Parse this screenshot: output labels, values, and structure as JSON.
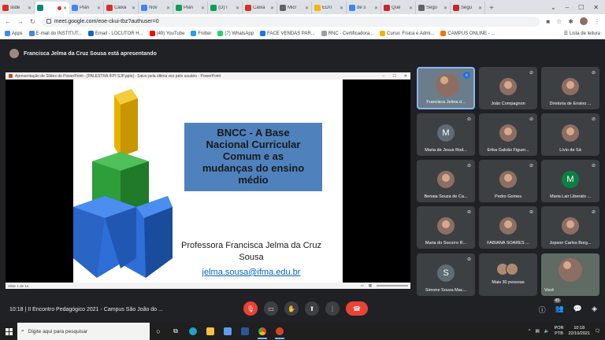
{
  "browser": {
    "tabs": [
      {
        "label": "slide",
        "favicon": "gmail-icon",
        "color": "#d93025"
      },
      {
        "label": "",
        "favicon": "meet-icon",
        "color": "#00897b",
        "active": true,
        "recording": true
      },
      {
        "label": "Plan",
        "favicon": "docs-icon",
        "color": "#4285f4"
      },
      {
        "label": "Caixa",
        "favicon": "gmail-icon",
        "color": "#d93025"
      },
      {
        "label": "Nov",
        "favicon": "docs-icon",
        "color": "#4285f4"
      },
      {
        "label": "Plan",
        "favicon": "sheets-icon",
        "color": "#0f9d58"
      },
      {
        "label": "(D) I",
        "favicon": "sheets-icon",
        "color": "#0f9d58"
      },
      {
        "label": "Caixa",
        "favicon": "gmail-icon",
        "color": "#d93025"
      },
      {
        "label": "Micr",
        "favicon": "globe-icon",
        "color": "#5f6368"
      },
      {
        "label": "EDIT",
        "favicon": "edit-icon",
        "color": "#f4b400"
      },
      {
        "label": "de s",
        "favicon": "google-icon",
        "color": "#4285f4"
      },
      {
        "label": "Que",
        "favicon": "m-icon",
        "color": "#c62828"
      },
      {
        "label": "Segu",
        "favicon": "globe-icon",
        "color": "#5f6368"
      },
      {
        "label": "Segu",
        "favicon": "m-icon",
        "color": "#c62828"
      }
    ],
    "url": "meet.google.com/eoe-ckui-tbz?authuser=0",
    "bookmarks": [
      {
        "label": "Apps",
        "color": "#4285f4"
      },
      {
        "label": "E-mail do INSTITUT...",
        "color": "#4285f4"
      },
      {
        "label": "Email - LOCUTOR H...",
        "color": "#1565c0"
      },
      {
        "label": "(49) YouTube",
        "color": "#ff0000"
      },
      {
        "label": "Fnitter",
        "color": "#1da1f2"
      },
      {
        "label": "(7) WhatsApp",
        "color": "#25d366"
      },
      {
        "label": "FACE VENDAS PAR...",
        "color": "#1877f2"
      },
      {
        "label": "RNC - Certificadora...",
        "color": "#9e9e9e"
      },
      {
        "label": "Curso: Física e Admi...",
        "color": "#f4b400"
      },
      {
        "label": "CAMPUS ONLINE - ...",
        "color": "#ff6f00"
      }
    ],
    "reading_list": "Lista de leitura"
  },
  "meet": {
    "presenting": "Francisca Jelma da Cruz Sousa está apresentando",
    "ppt_window_title": "Apresentação de Slides do PowerPoint - [PALESTRA IFPI SJP.pptx] - Salvo pela última vez pelo usuário - PowerPoint",
    "ppt_status": "Slide 1 de 14",
    "slide": {
      "title": "BNCC - A Base\nNacional Curricular\nComum e as\nmudanças do ensino\nmédio",
      "author": "Professora Francisca Jelma da Cruz Sousa",
      "email": "jelma.sousa@ifma.edu.br"
    },
    "participants": [
      {
        "name": "Francisca Jelma d...",
        "type": "speaking"
      },
      {
        "name": "João Compagnon",
        "type": "photo"
      },
      {
        "name": "Diretoria de Ensino ...",
        "type": "photo"
      },
      {
        "name": "Maria de Jesus Rod...",
        "type": "letter",
        "letter": "M",
        "color": "#5f6b75"
      },
      {
        "name": "Erika Galvão Figuer...",
        "type": "photo"
      },
      {
        "name": "Lívio de Sá",
        "type": "photo"
      },
      {
        "name": "Benaia Souza de Ca...",
        "type": "photo"
      },
      {
        "name": "Pedro Gomes",
        "type": "photo"
      },
      {
        "name": "Maria Lair Liberato ...",
        "type": "letter",
        "letter": "M",
        "color": "#0b8043"
      },
      {
        "name": "Maria do Socorro R...",
        "type": "photo"
      },
      {
        "name": "FABIANA SOARES ...",
        "type": "photo"
      },
      {
        "name": "Jopson Carlos Borg...",
        "type": "photo"
      },
      {
        "name": "Simone Souza Mac...",
        "type": "letter",
        "letter": "S",
        "color": "#5f6b75"
      },
      {
        "name": "Mais 30 pessoas",
        "type": "more"
      },
      {
        "name": "Você",
        "type": "video"
      }
    ],
    "time": "10:18",
    "meeting_title": "II Encontro Pedagógico 2021 - Campus São João do ...",
    "participant_count": "45"
  },
  "taskbar": {
    "search_placeholder": "Digite aqui para pesquisar",
    "lang_top": "POR",
    "lang_bottom": "PTB",
    "clock_time": "10:18",
    "clock_date": "22/10/2021"
  }
}
